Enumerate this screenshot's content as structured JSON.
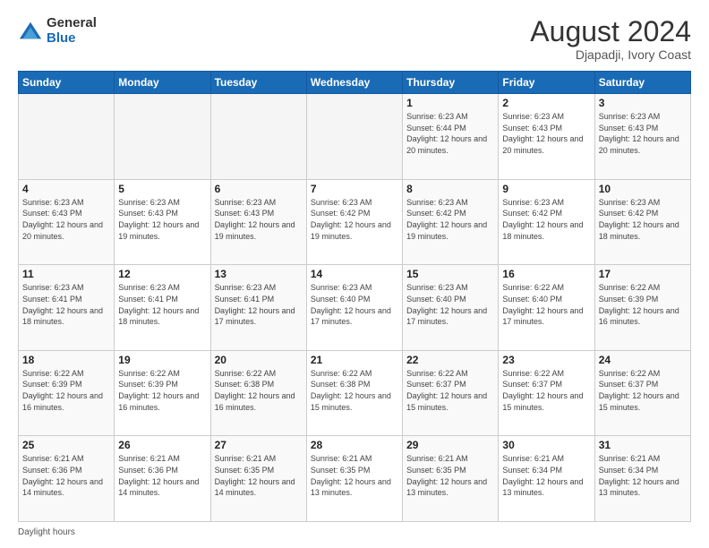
{
  "header": {
    "logo_general": "General",
    "logo_blue": "Blue",
    "main_title": "August 2024",
    "sub_title": "Djapadji, Ivory Coast"
  },
  "calendar": {
    "days_of_week": [
      "Sunday",
      "Monday",
      "Tuesday",
      "Wednesday",
      "Thursday",
      "Friday",
      "Saturday"
    ],
    "weeks": [
      [
        {
          "day": "",
          "info": ""
        },
        {
          "day": "",
          "info": ""
        },
        {
          "day": "",
          "info": ""
        },
        {
          "day": "",
          "info": ""
        },
        {
          "day": "1",
          "info": "Sunrise: 6:23 AM\nSunset: 6:44 PM\nDaylight: 12 hours\nand 20 minutes."
        },
        {
          "day": "2",
          "info": "Sunrise: 6:23 AM\nSunset: 6:43 PM\nDaylight: 12 hours\nand 20 minutes."
        },
        {
          "day": "3",
          "info": "Sunrise: 6:23 AM\nSunset: 6:43 PM\nDaylight: 12 hours\nand 20 minutes."
        }
      ],
      [
        {
          "day": "4",
          "info": "Sunrise: 6:23 AM\nSunset: 6:43 PM\nDaylight: 12 hours\nand 20 minutes."
        },
        {
          "day": "5",
          "info": "Sunrise: 6:23 AM\nSunset: 6:43 PM\nDaylight: 12 hours\nand 19 minutes."
        },
        {
          "day": "6",
          "info": "Sunrise: 6:23 AM\nSunset: 6:43 PM\nDaylight: 12 hours\nand 19 minutes."
        },
        {
          "day": "7",
          "info": "Sunrise: 6:23 AM\nSunset: 6:42 PM\nDaylight: 12 hours\nand 19 minutes."
        },
        {
          "day": "8",
          "info": "Sunrise: 6:23 AM\nSunset: 6:42 PM\nDaylight: 12 hours\nand 19 minutes."
        },
        {
          "day": "9",
          "info": "Sunrise: 6:23 AM\nSunset: 6:42 PM\nDaylight: 12 hours\nand 18 minutes."
        },
        {
          "day": "10",
          "info": "Sunrise: 6:23 AM\nSunset: 6:42 PM\nDaylight: 12 hours\nand 18 minutes."
        }
      ],
      [
        {
          "day": "11",
          "info": "Sunrise: 6:23 AM\nSunset: 6:41 PM\nDaylight: 12 hours\nand 18 minutes."
        },
        {
          "day": "12",
          "info": "Sunrise: 6:23 AM\nSunset: 6:41 PM\nDaylight: 12 hours\nand 18 minutes."
        },
        {
          "day": "13",
          "info": "Sunrise: 6:23 AM\nSunset: 6:41 PM\nDaylight: 12 hours\nand 17 minutes."
        },
        {
          "day": "14",
          "info": "Sunrise: 6:23 AM\nSunset: 6:40 PM\nDaylight: 12 hours\nand 17 minutes."
        },
        {
          "day": "15",
          "info": "Sunrise: 6:23 AM\nSunset: 6:40 PM\nDaylight: 12 hours\nand 17 minutes."
        },
        {
          "day": "16",
          "info": "Sunrise: 6:22 AM\nSunset: 6:40 PM\nDaylight: 12 hours\nand 17 minutes."
        },
        {
          "day": "17",
          "info": "Sunrise: 6:22 AM\nSunset: 6:39 PM\nDaylight: 12 hours\nand 16 minutes."
        }
      ],
      [
        {
          "day": "18",
          "info": "Sunrise: 6:22 AM\nSunset: 6:39 PM\nDaylight: 12 hours\nand 16 minutes."
        },
        {
          "day": "19",
          "info": "Sunrise: 6:22 AM\nSunset: 6:39 PM\nDaylight: 12 hours\nand 16 minutes."
        },
        {
          "day": "20",
          "info": "Sunrise: 6:22 AM\nSunset: 6:38 PM\nDaylight: 12 hours\nand 16 minutes."
        },
        {
          "day": "21",
          "info": "Sunrise: 6:22 AM\nSunset: 6:38 PM\nDaylight: 12 hours\nand 15 minutes."
        },
        {
          "day": "22",
          "info": "Sunrise: 6:22 AM\nSunset: 6:37 PM\nDaylight: 12 hours\nand 15 minutes."
        },
        {
          "day": "23",
          "info": "Sunrise: 6:22 AM\nSunset: 6:37 PM\nDaylight: 12 hours\nand 15 minutes."
        },
        {
          "day": "24",
          "info": "Sunrise: 6:22 AM\nSunset: 6:37 PM\nDaylight: 12 hours\nand 15 minutes."
        }
      ],
      [
        {
          "day": "25",
          "info": "Sunrise: 6:21 AM\nSunset: 6:36 PM\nDaylight: 12 hours\nand 14 minutes."
        },
        {
          "day": "26",
          "info": "Sunrise: 6:21 AM\nSunset: 6:36 PM\nDaylight: 12 hours\nand 14 minutes."
        },
        {
          "day": "27",
          "info": "Sunrise: 6:21 AM\nSunset: 6:35 PM\nDaylight: 12 hours\nand 14 minutes."
        },
        {
          "day": "28",
          "info": "Sunrise: 6:21 AM\nSunset: 6:35 PM\nDaylight: 12 hours\nand 13 minutes."
        },
        {
          "day": "29",
          "info": "Sunrise: 6:21 AM\nSunset: 6:35 PM\nDaylight: 12 hours\nand 13 minutes."
        },
        {
          "day": "30",
          "info": "Sunrise: 6:21 AM\nSunset: 6:34 PM\nDaylight: 12 hours\nand 13 minutes."
        },
        {
          "day": "31",
          "info": "Sunrise: 6:21 AM\nSunset: 6:34 PM\nDaylight: 12 hours\nand 13 minutes."
        }
      ]
    ]
  },
  "footer": {
    "text": "Daylight hours"
  }
}
